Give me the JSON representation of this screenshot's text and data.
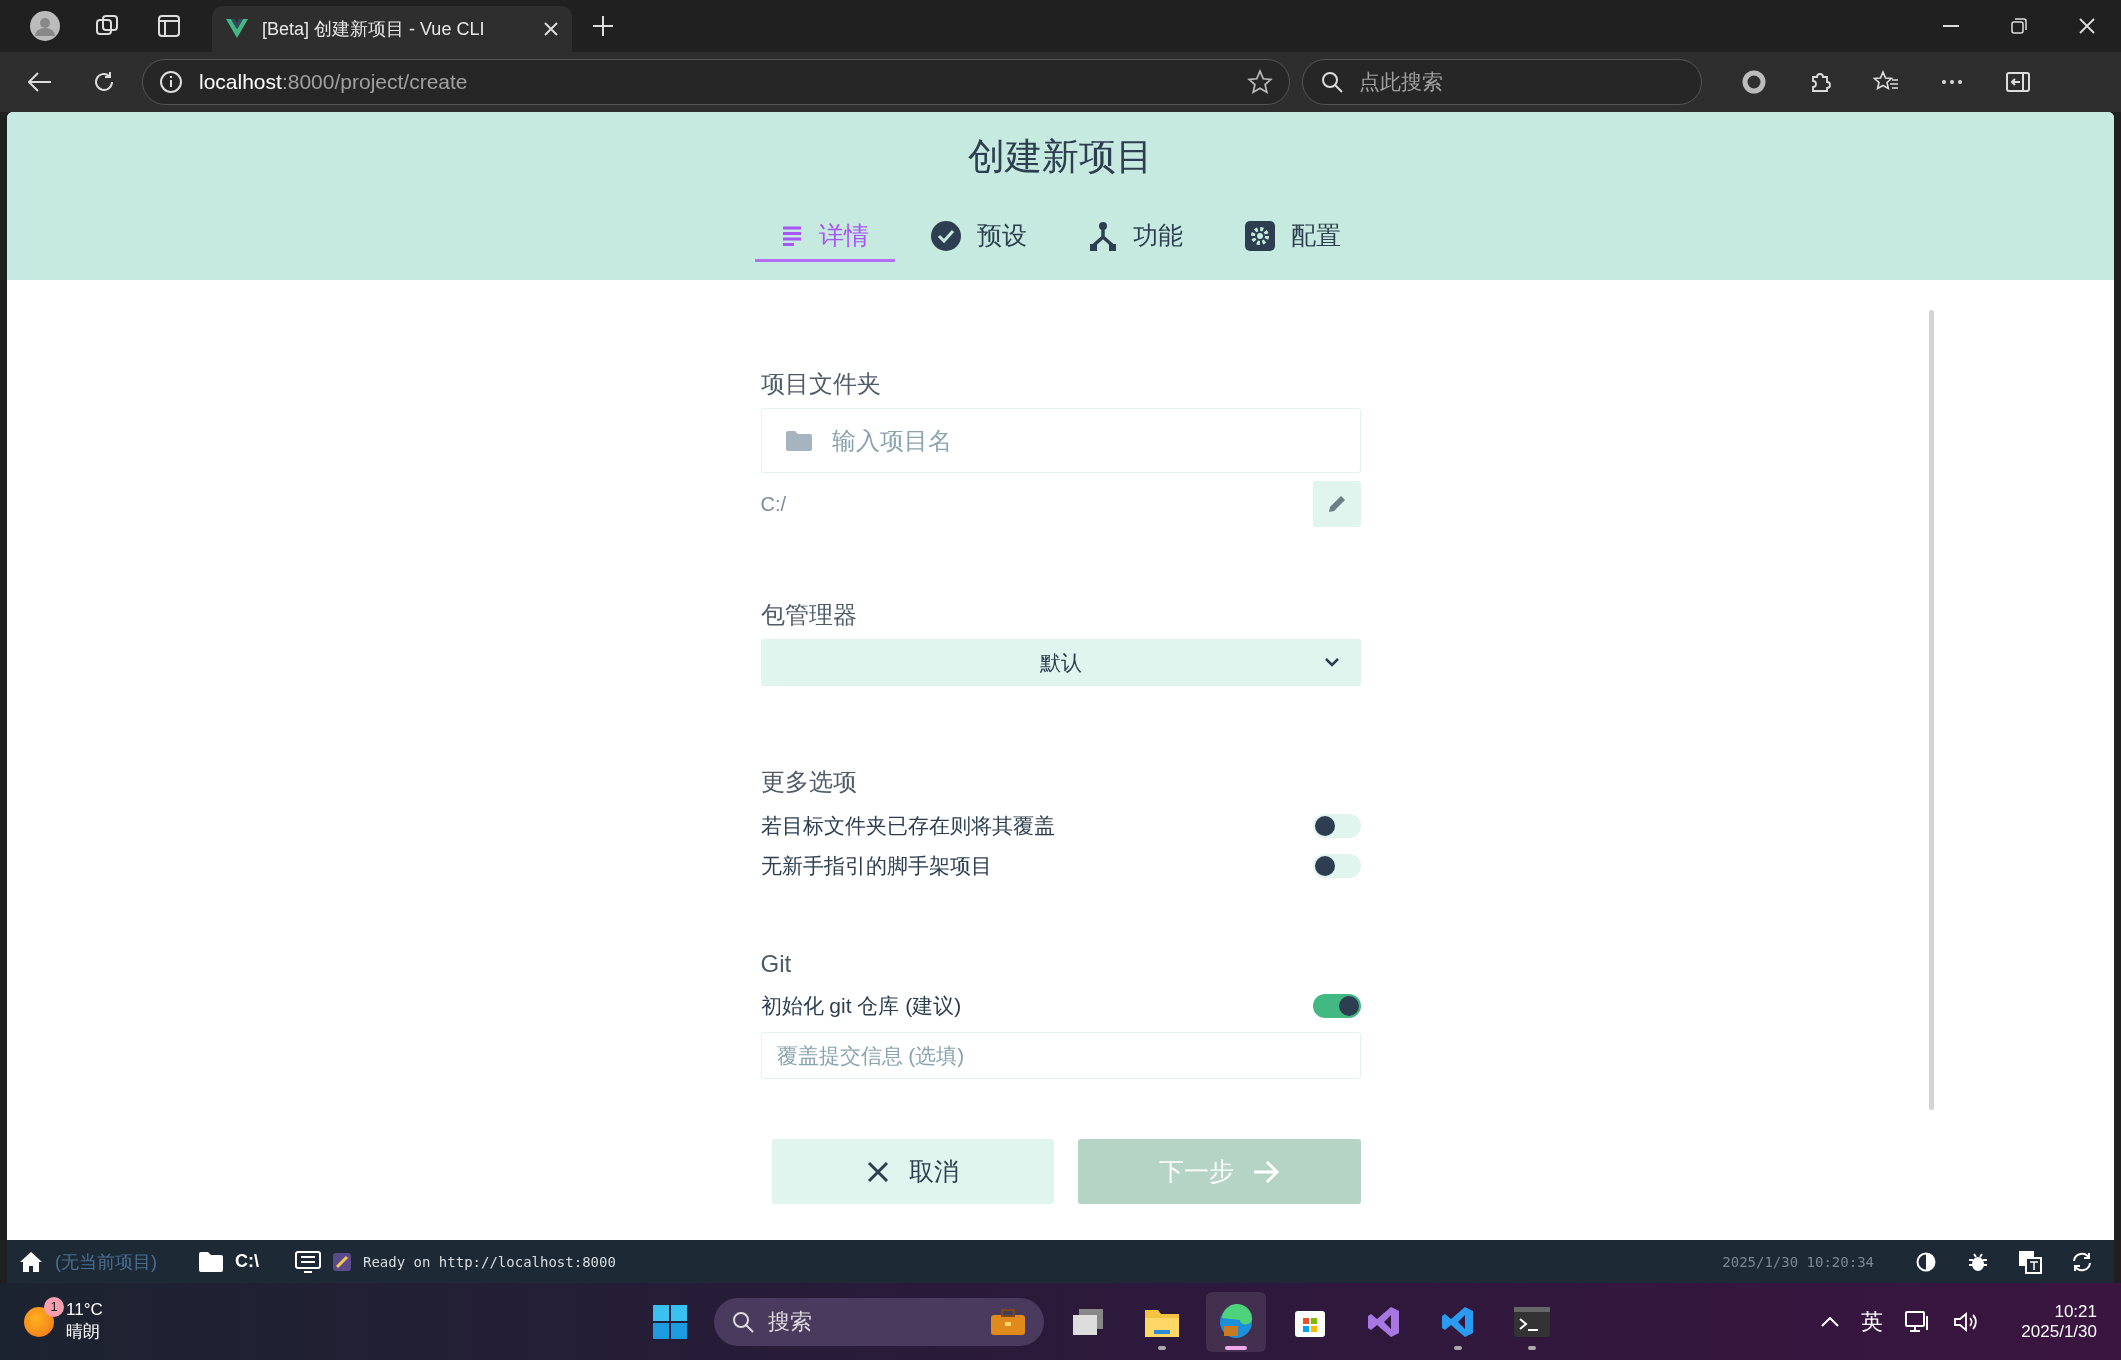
{
  "browser": {
    "tab_title": "[Beta] 创建新项目 - Vue CLI",
    "url_host": "localhost",
    "url_path": ":8000/project/create",
    "search_placeholder": "点此搜索"
  },
  "page": {
    "title": "创建新项目",
    "tabs": [
      {
        "label": "详情",
        "kind": "details",
        "selected": true
      },
      {
        "label": "预设",
        "kind": "presets",
        "selected": false
      },
      {
        "label": "功能",
        "kind": "features",
        "selected": false
      },
      {
        "label": "配置",
        "kind": "config",
        "selected": false
      }
    ],
    "folder": {
      "label": "项目文件夹",
      "placeholder": "输入项目名",
      "path": "C:/"
    },
    "package_manager": {
      "label": "包管理器",
      "value": "默认"
    },
    "more_options": {
      "label": "更多选项",
      "options": [
        {
          "label": "若目标文件夹已存在则将其覆盖",
          "on": false
        },
        {
          "label": "无新手指引的脚手架项目",
          "on": false
        }
      ]
    },
    "git": {
      "label": "Git",
      "option": {
        "label": "初始化 git 仓库 (建议)",
        "on": true
      },
      "placeholder": "覆盖提交信息 (选填)"
    },
    "buttons": [
      {
        "label": "取消",
        "kind": "cancel",
        "disabled": false
      },
      {
        "label": "下一步",
        "kind": "next",
        "disabled": true
      }
    ]
  },
  "status_bar": {
    "project": "(无当前项目)",
    "folder": "C:\\",
    "log": "Ready on http://localhost:8000",
    "time": "2025/1/30 10:20:34"
  },
  "taskbar": {
    "weather": {
      "badge": "1",
      "temp": "11°C",
      "condition": "晴朗"
    },
    "search": "搜索",
    "apps": [
      {
        "kind": "taskview",
        "running": false,
        "selected": false
      },
      {
        "kind": "explorer",
        "running": true,
        "selected": false
      },
      {
        "kind": "edge",
        "running": true,
        "selected": true
      },
      {
        "kind": "store",
        "running": false,
        "selected": false
      },
      {
        "kind": "vs",
        "running": false,
        "selected": false
      },
      {
        "kind": "vscode",
        "running": true,
        "selected": false
      },
      {
        "kind": "terminal",
        "running": true,
        "selected": false
      }
    ],
    "ime": "英",
    "clock_time": "10:21",
    "clock_date": "2025/1/30"
  }
}
